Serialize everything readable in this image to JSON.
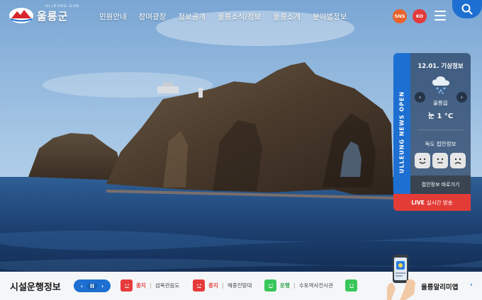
{
  "header": {
    "logo_text": "울릉군",
    "logo_sub": "ULLEUNG-GUN",
    "nav": [
      "민원안내",
      "참여광장",
      "정보공개",
      "울릉소식/정보",
      "울릉소개",
      "분야별정보"
    ],
    "sns_label": "SNS",
    "lang_label": "KO"
  },
  "news_tab": {
    "label": "ULLEUNG NEWS OPEN"
  },
  "weather": {
    "date": "12.01. 기상정보",
    "location": "울릉읍",
    "condition": "눈",
    "temperature": "1 °C",
    "dokdo_label": "독도 접안정보",
    "link_label": "접안정보 바로가기",
    "live_prefix": "LIVE",
    "live_label": "실시간 방송"
  },
  "bottom": {
    "title": "시설운행정보",
    "controls": {
      "prev": "‹",
      "pause": "II",
      "next": "›"
    },
    "facilities": [
      {
        "state": "중지",
        "name": "섬목관음도",
        "status": "red"
      },
      {
        "state": "중지",
        "name": "해중전망대",
        "status": "red"
      },
      {
        "state": "운행",
        "name": "수토역사전시관",
        "status": "green"
      }
    ],
    "app_label": "울릉알리미앱",
    "app_arrow": "›"
  },
  "colors": {
    "accent": "#1d6fd1",
    "stop": "#e63b3b",
    "run": "#39c65a",
    "live": "#e33b36"
  }
}
